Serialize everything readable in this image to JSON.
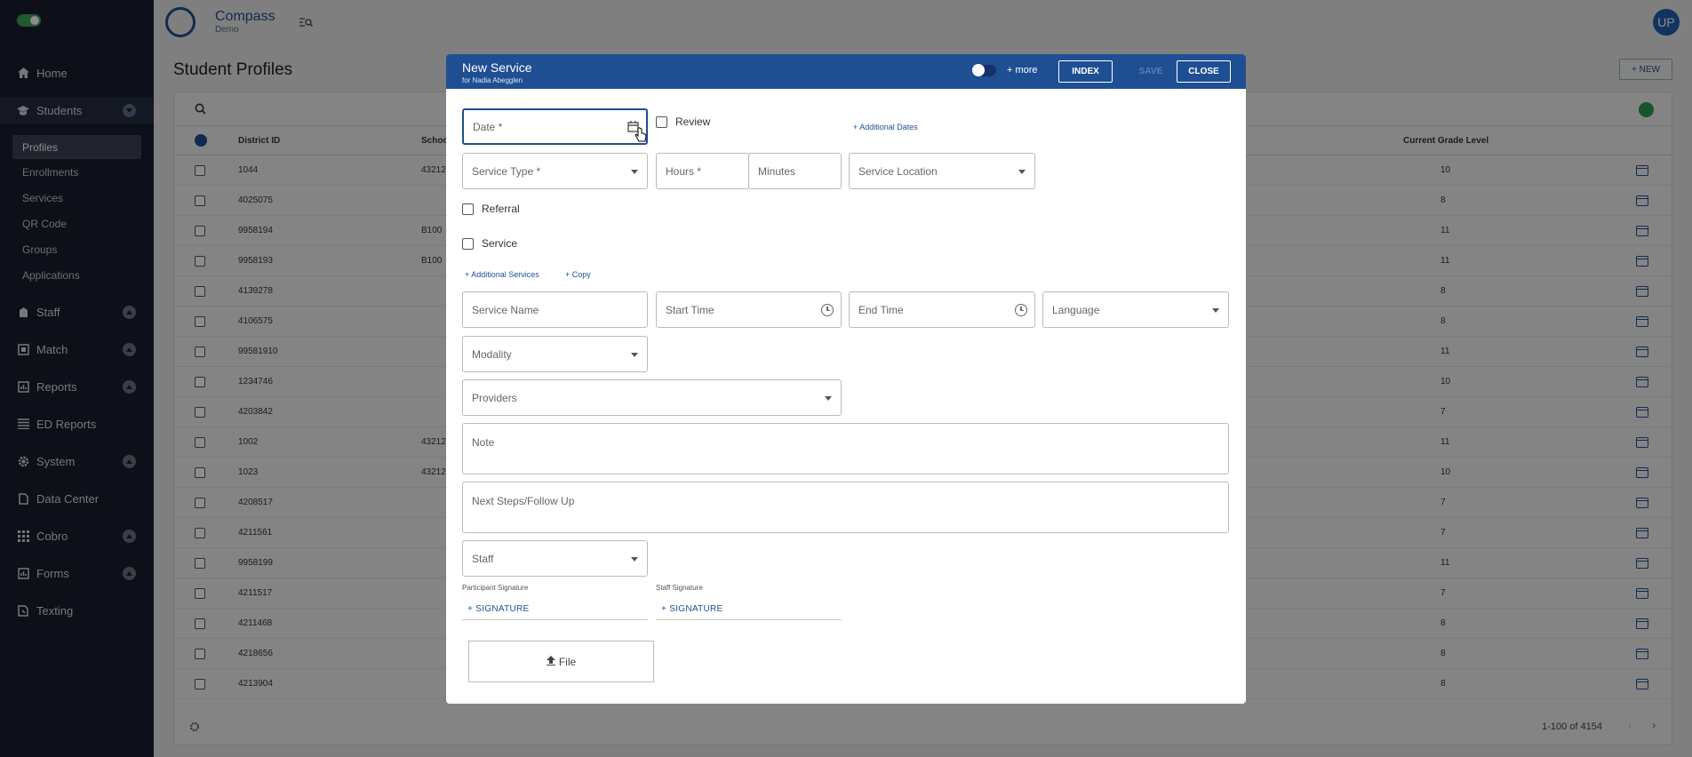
{
  "sidebar": {
    "items": [
      {
        "label": "Home",
        "icon": "home-icon"
      },
      {
        "label": "Students",
        "icon": "graduation-cap-icon"
      },
      {
        "label": "Staff",
        "icon": "staff-icon"
      },
      {
        "label": "Match",
        "icon": "match-icon"
      },
      {
        "label": "Reports",
        "icon": "reports-icon"
      },
      {
        "label": "ED Reports",
        "icon": "list-icon"
      },
      {
        "label": "System",
        "icon": "gear-icon"
      },
      {
        "label": "Data Center",
        "icon": "data-center-icon"
      },
      {
        "label": "Cobro",
        "icon": "grid-icon"
      },
      {
        "label": "Forms",
        "icon": "forms-icon"
      },
      {
        "label": "Texting",
        "icon": "texting-icon"
      }
    ],
    "students_sub": [
      "Profiles",
      "Enrollments",
      "Services",
      "QR Code",
      "Groups",
      "Applications"
    ]
  },
  "brand": {
    "name": "Compass",
    "sub": "Demo"
  },
  "user": {
    "initials": "UP"
  },
  "page": {
    "title": "Student Profiles",
    "new_label": "+ NEW"
  },
  "table": {
    "columns": {
      "district_id": "District ID",
      "school": "Schoo",
      "grade": "Current Grade Level"
    },
    "rows": [
      {
        "id": "1044",
        "school": "43212",
        "grade": "10"
      },
      {
        "id": "4025075",
        "school": "",
        "grade": "8"
      },
      {
        "id": "9958194",
        "school": "B100",
        "grade": "11"
      },
      {
        "id": "9958193",
        "school": "B100",
        "grade": "11"
      },
      {
        "id": "4139278",
        "school": "",
        "grade": "8"
      },
      {
        "id": "4106575",
        "school": "",
        "grade": "8"
      },
      {
        "id": "99581910",
        "school": "",
        "grade": "11"
      },
      {
        "id": "1234746",
        "school": "",
        "grade": "10"
      },
      {
        "id": "4203842",
        "school": "",
        "grade": "7"
      },
      {
        "id": "1002",
        "school": "43212",
        "grade": "11"
      },
      {
        "id": "1023",
        "school": "43212",
        "grade": "10"
      },
      {
        "id": "4208517",
        "school": "",
        "grade": "7"
      },
      {
        "id": "4211561",
        "school": "",
        "grade": "7"
      },
      {
        "id": "9958199",
        "school": "",
        "grade": "11"
      },
      {
        "id": "4211517",
        "school": "",
        "grade": "7"
      },
      {
        "id": "4211468",
        "school": "",
        "grade": "8"
      },
      {
        "id": "4218656",
        "school": "",
        "grade": "8"
      },
      {
        "id": "4213904",
        "school": "",
        "grade": "8"
      }
    ],
    "pagination": "1-100 of 4154"
  },
  "modal": {
    "title": "New Service",
    "subtitle": "for Nadia Abegglen",
    "more": "+ more",
    "index": "INDEX",
    "save": "SAVE",
    "close": "CLOSE",
    "date": "Date *",
    "review": "Review",
    "additional_dates": "+ Additional Dates",
    "service_type": "Service Type *",
    "hours": "Hours *",
    "minutes": "Minutes",
    "service_location": "Service Location",
    "referral": "Referral",
    "service": "Service",
    "additional_services": "+ Additional Services",
    "copy": "+ Copy",
    "service_name": "Service Name",
    "start_time": "Start Time",
    "end_time": "End Time",
    "language": "Language",
    "modality": "Modality",
    "providers": "Providers",
    "note": "Note",
    "next_steps": "Next Steps/Follow Up",
    "staff": "Staff",
    "participant_signature": "Participant Signature",
    "staff_signature": "Staff Signature",
    "signature_btn": "+ SIGNATURE",
    "file": "File"
  }
}
